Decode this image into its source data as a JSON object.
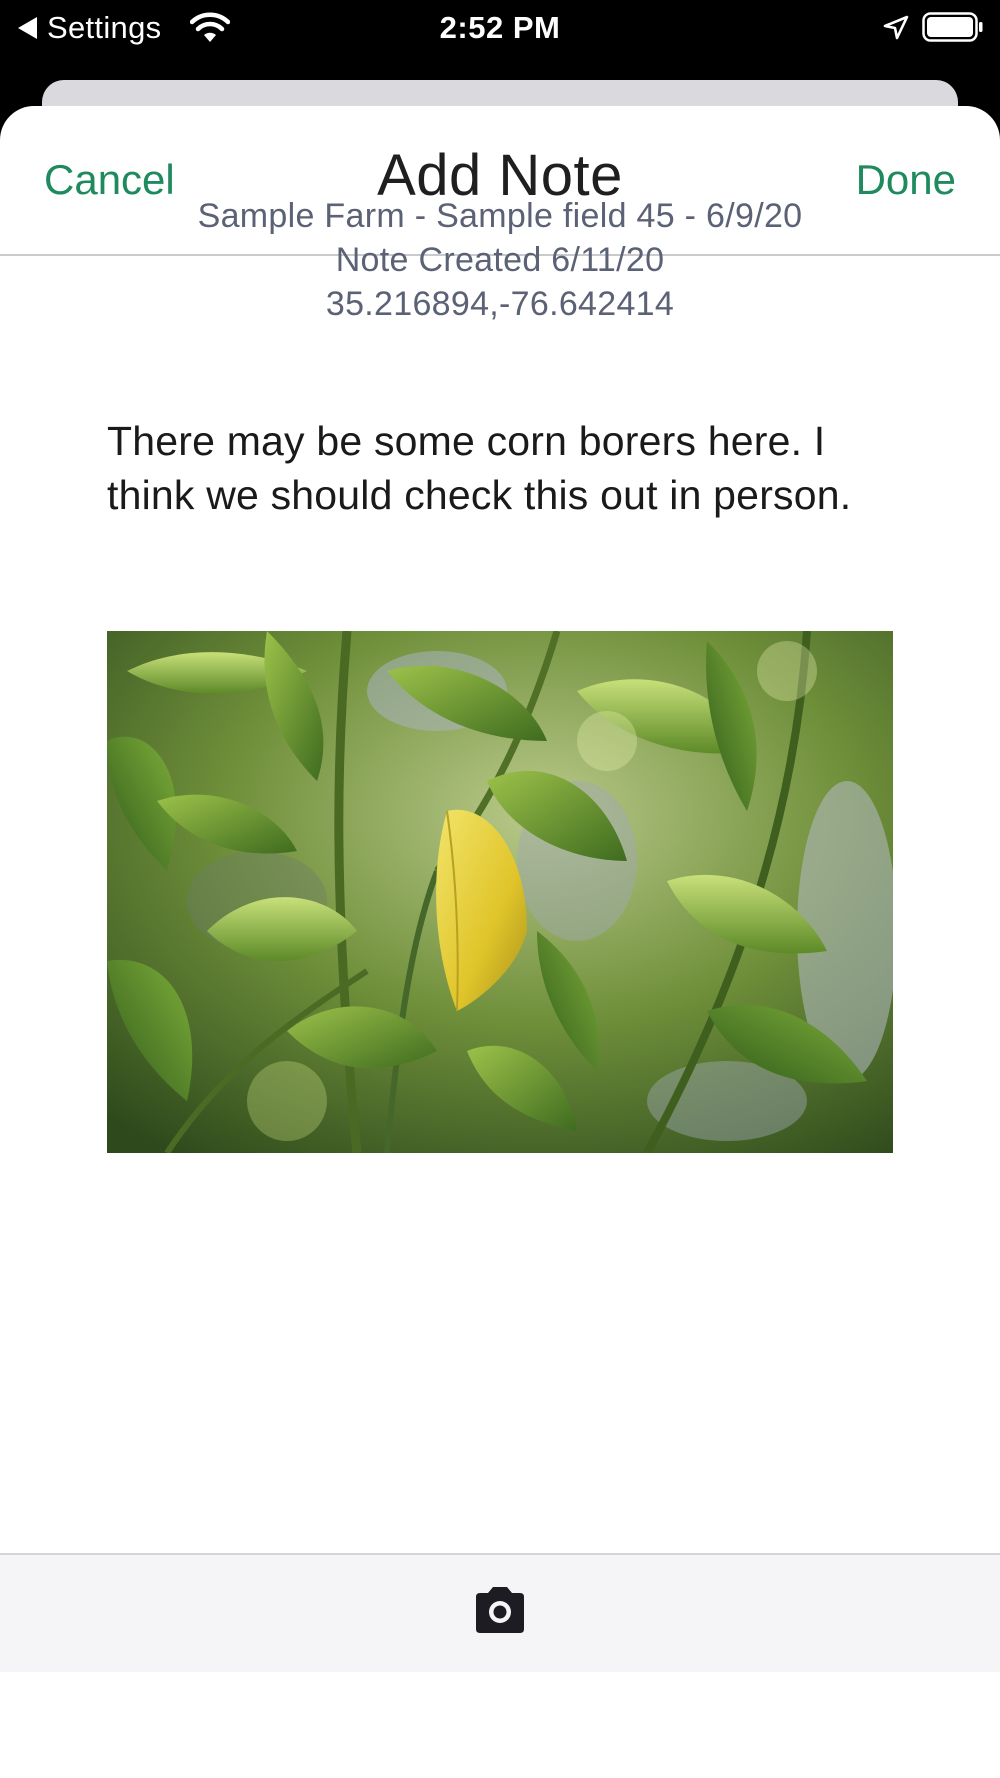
{
  "status_bar": {
    "back_label": "Settings",
    "time": "2:52 PM",
    "icons": [
      "back-arrow-icon",
      "wifi-icon",
      "location-arrow-icon",
      "battery-icon"
    ]
  },
  "nav": {
    "cancel_label": "Cancel",
    "title": "Add Note",
    "done_label": "Done"
  },
  "note_meta": {
    "field_line": "Sample Farm - Sample field 45 - 6/9/20",
    "created_line": "Note Created 6/11/20",
    "coordinates": "35.216894,-76.642414"
  },
  "note": {
    "text": "There may be some corn borers here. I think we should check this out in person."
  },
  "photo": {
    "icon": "photo-plant-leaves"
  },
  "toolbar": {
    "camera_icon": "camera-icon"
  },
  "colors": {
    "accent": "#1e8a5e",
    "meta_text": "#5c6275",
    "toolbar_bg": "#f5f5f7"
  }
}
